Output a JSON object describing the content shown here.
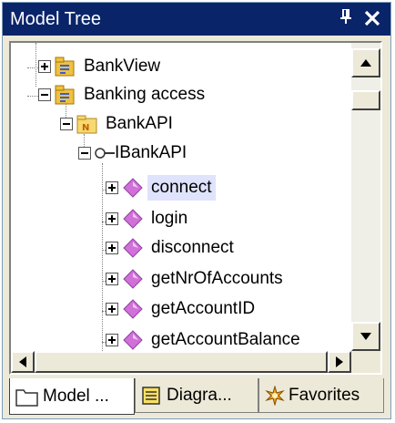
{
  "panel": {
    "title": "Model Tree",
    "pin_glyph": "ք",
    "close_glyph": "✕"
  },
  "tree": {
    "items": [
      {
        "label": "BankView",
        "expander": "plus",
        "icon": "package-icon"
      },
      {
        "label": "Banking access",
        "expander": "minus",
        "icon": "package-icon"
      },
      {
        "label": "BankAPI",
        "expander": "minus",
        "icon": "namespace-folder-icon"
      },
      {
        "label": "IBankAPI",
        "expander": "minus",
        "icon": "interface-icon"
      },
      {
        "label": "connect",
        "expander": "plus",
        "icon": "operation-icon",
        "selected": true
      },
      {
        "label": "login",
        "expander": "plus",
        "icon": "operation-icon"
      },
      {
        "label": "disconnect",
        "expander": "plus",
        "icon": "operation-icon"
      },
      {
        "label": "getNrOfAccounts",
        "expander": "plus",
        "icon": "operation-icon"
      },
      {
        "label": "getAccountID",
        "expander": "plus",
        "icon": "operation-icon"
      },
      {
        "label": "getAccountBalance",
        "expander": "plus",
        "icon": "operation-icon"
      }
    ]
  },
  "tabs": [
    {
      "label": "Model ...",
      "icon": "folder-icon",
      "active": true
    },
    {
      "label": "Diagra...",
      "icon": "diagram-list-icon",
      "active": false
    },
    {
      "label": "Favorites",
      "icon": "favorites-star-icon",
      "active": false
    }
  ],
  "colors": {
    "titlebar": "#0a246a",
    "selection": "#dfe3fb",
    "operation": "#d070d8",
    "package": "#f0c040"
  }
}
